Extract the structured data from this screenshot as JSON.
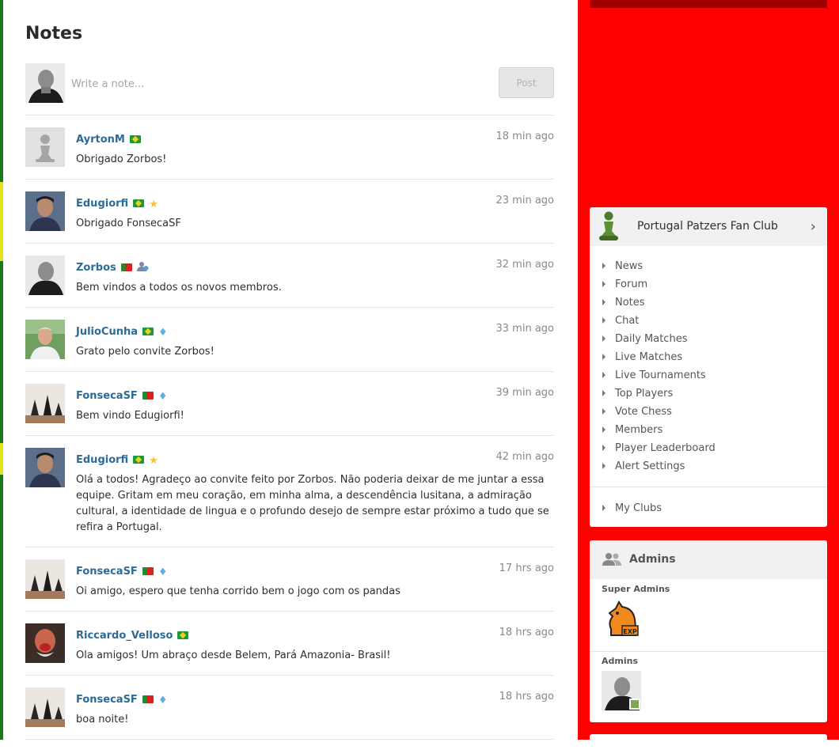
{
  "notes": {
    "title": "Notes",
    "composer": {
      "placeholder": "Write a note...",
      "post_label": "Post"
    },
    "items": [
      {
        "user": "AyrtonM",
        "flag": "brazil-flag",
        "badge": "",
        "time": "18 min ago",
        "text": "Obrigado Zorbos!"
      },
      {
        "user": "Edugiorfi",
        "flag": "brazil-flag",
        "badge": "star-icon",
        "time": "23 min ago",
        "text": "Obrigado FonsecaSF"
      },
      {
        "user": "Zorbos",
        "flag": "portugal-flag",
        "badge": "staff-icon",
        "time": "32 min ago",
        "text": "Bem vindos a todos os novos membros."
      },
      {
        "user": "JulioCunha",
        "flag": "brazil-flag",
        "badge": "diamond-icon",
        "time": "33 min ago",
        "text": "Grato pelo convite Zorbos!"
      },
      {
        "user": "FonsecaSF",
        "flag": "portugal-flag",
        "badge": "diamond-icon",
        "time": "39 min ago",
        "text": "Bem vindo Edugiorfi!"
      },
      {
        "user": "Edugiorfi",
        "flag": "brazil-flag",
        "badge": "star-icon",
        "time": "42 min ago",
        "text": "Olá a todos! Agradeço ao convite feito por Zorbos. Não poderia deixar de me juntar a essa equipe. Gritam em meu coração, em minha alma, a descendência lusitana, a admiração cultural, a identidade de lingua e o profundo desejo de sempre estar próximo a tudo que se refira a Portugal."
      },
      {
        "user": "FonsecaSF",
        "flag": "portugal-flag",
        "badge": "diamond-icon",
        "time": "17 hrs ago",
        "text": "Oi amigo, espero que tenha corrido bem o jogo com os pandas"
      },
      {
        "user": "Riccardo_Velloso",
        "flag": "brazil-flag",
        "badge": "",
        "time": "18 hrs ago",
        "text": "Ola amigos! Um abraço desde Belem, Pará Amazonia- Brasil!"
      },
      {
        "user": "FonsecaSF",
        "flag": "portugal-flag",
        "badge": "diamond-icon",
        "time": "18 hrs ago",
        "text": "boa noite!"
      }
    ]
  },
  "club": {
    "name": "Portugal Patzers Fan Club",
    "menu": [
      "News",
      "Forum",
      "Notes",
      "Chat",
      "Daily Matches",
      "Live Matches",
      "Live Tournaments",
      "Top Players",
      "Vote Chess",
      "Members",
      "Player Leaderboard",
      "Alert Settings"
    ],
    "my_clubs": "My Clubs"
  },
  "admins": {
    "title": "Admins",
    "super_admins_label": "Super Admins",
    "super_admin_logo_text": "EXP",
    "admins_label": "Admins"
  },
  "colors": {
    "accent_red": "#ff0000",
    "username_blue": "#2c6b98",
    "online_green": "#7fa650"
  }
}
